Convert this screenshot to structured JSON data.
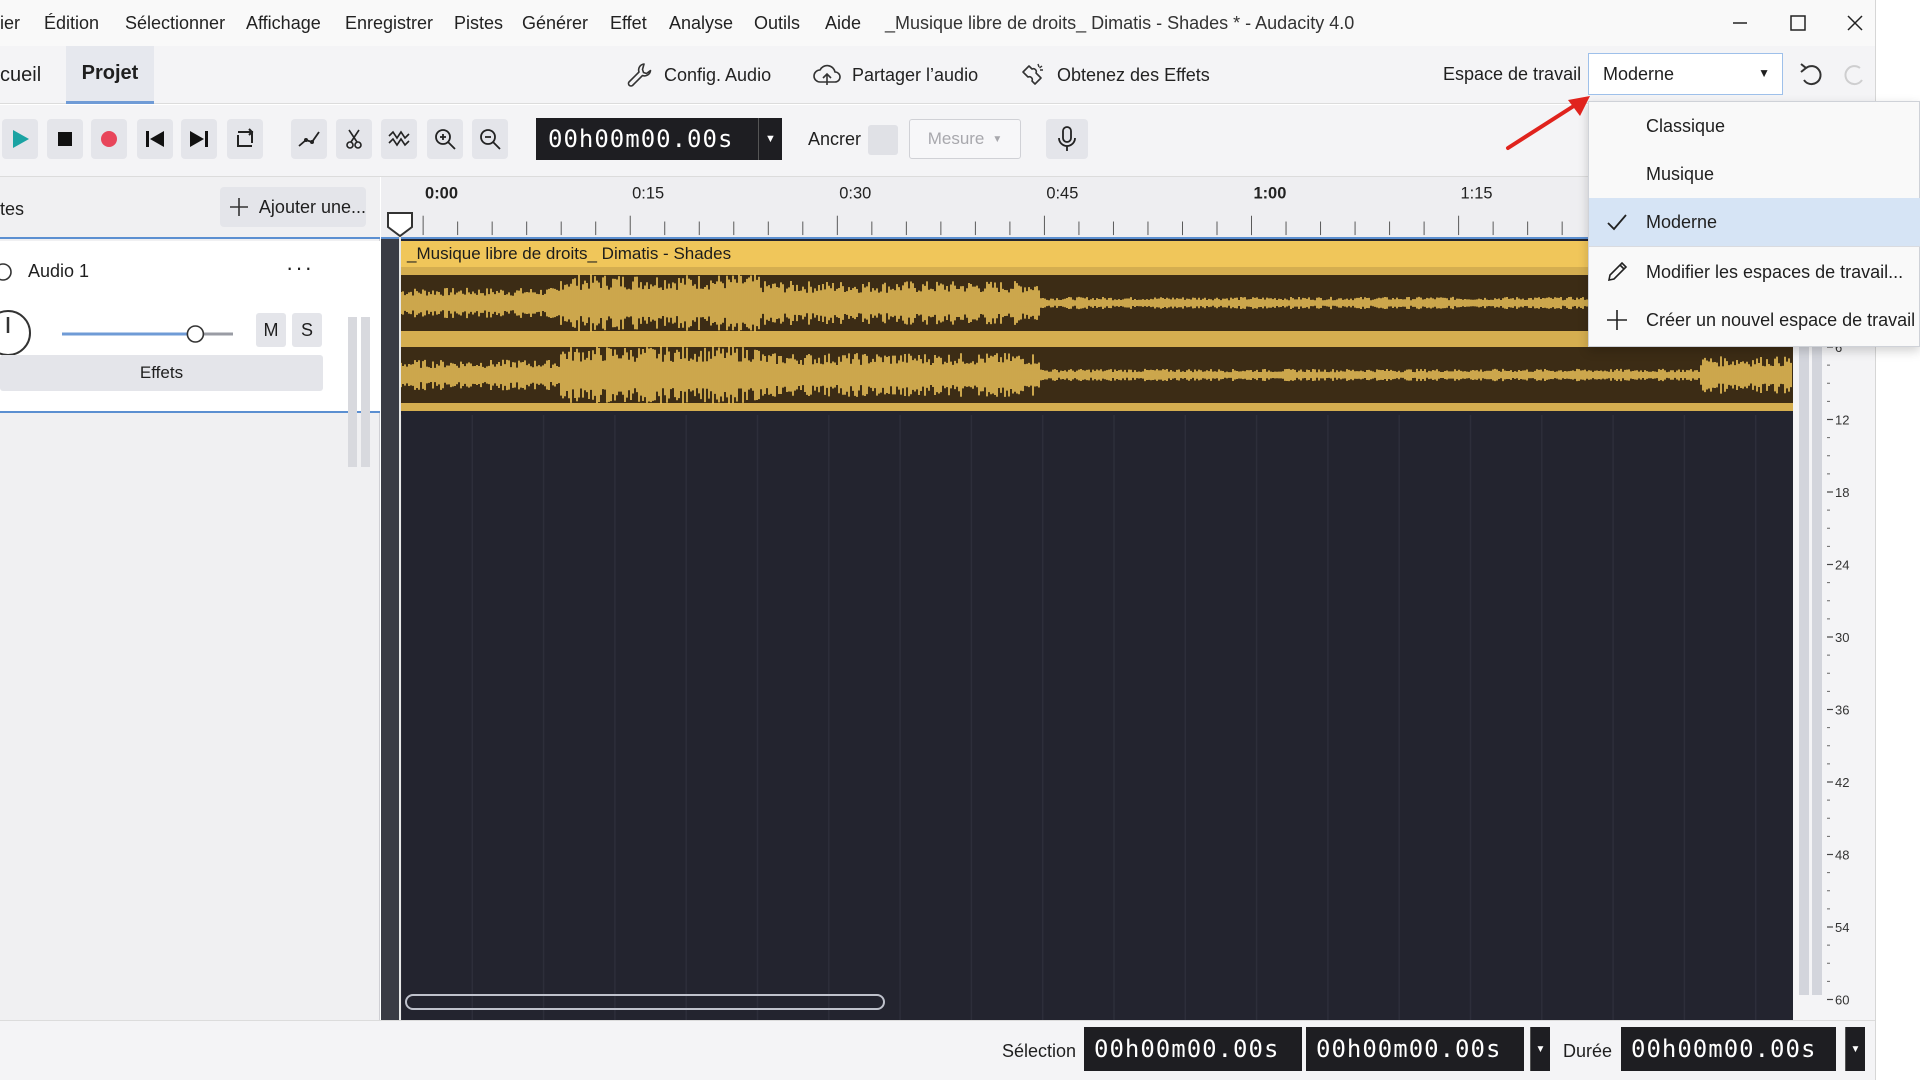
{
  "window": {
    "title": "_Musique libre de droits_ Dimatis - Shades * - Audacity 4.0"
  },
  "menu": [
    "ier",
    "Édition",
    "Sélectionner",
    "Affichage",
    "Enregistrer",
    "Pistes",
    "Générer",
    "Effet",
    "Analyse",
    "Outils",
    "Aide"
  ],
  "project_bar": {
    "tab_home": "cueil",
    "tab_project": "Projet",
    "audio_setup": "Config. Audio",
    "share_audio": "Partager l’audio",
    "get_effects": "Obtenez des Effets",
    "workspace_label": "Espace de travail",
    "workspace_value": "Moderne"
  },
  "transport": {
    "time": "00h00m00.00s",
    "snap_label": "Ancrer",
    "snap_checked": false,
    "measure_label": "Mesure"
  },
  "track_panel": {
    "header_label": "tes",
    "add_button": "Ajouter une...",
    "track_name": "Audio 1",
    "track_menu": "···",
    "mute": "M",
    "solo": "S",
    "effects": "Effets",
    "volume_level": 0.78
  },
  "timeline": {
    "ruler_labels": [
      "0:00",
      "0:15",
      "0:30",
      "0:45",
      "1:00",
      "1:15"
    ],
    "clip_title": "_Musique libre de droits_ Dimatis - Shades"
  },
  "meter": {
    "scale": [
      "6",
      "12",
      "18",
      "24",
      "30",
      "36",
      "42",
      "48",
      "54",
      "60"
    ],
    "partial_top": "6"
  },
  "status": {
    "selection_label": "Sélection",
    "selection_start": "00h00m00.00s",
    "selection_end": "00h00m00.00s",
    "duration_label": "Durée",
    "duration": "00h00m00.00s"
  },
  "workspace_dropdown": {
    "items": [
      {
        "label": "Classique",
        "icon": "none",
        "selected": false
      },
      {
        "label": "Musique",
        "icon": "none",
        "selected": false
      },
      {
        "label": "Moderne",
        "icon": "check-icon",
        "selected": true
      },
      {
        "label": "Modifier les espaces de travail...",
        "icon": "pencil-icon",
        "selected": false
      },
      {
        "label": "Créer un nouvel espace de travail",
        "icon": "plus-icon",
        "selected": false
      }
    ]
  },
  "colors": {
    "clip_header": "#f0c65a",
    "waveform": "#f0c65a",
    "waveform_bg": "#3c2c15",
    "timeline_bg": "#23242f",
    "accent": "#5b8fd1",
    "play": "#1aa3a3",
    "record": "#e8455a",
    "annotation_arrow": "#e0231d"
  }
}
